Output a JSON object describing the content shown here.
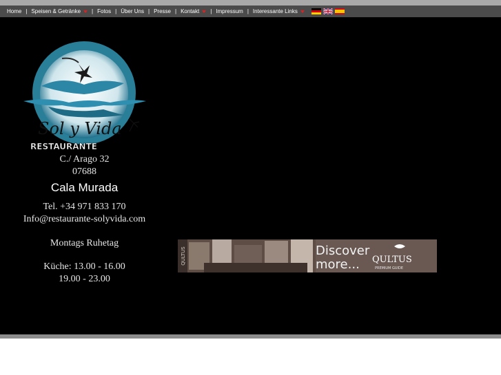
{
  "nav": {
    "items": [
      {
        "label": "Home",
        "dropdown": false
      },
      {
        "label": "Speisen & Getränke",
        "dropdown": true
      },
      {
        "label": "Fotos",
        "dropdown": false
      },
      {
        "label": "Über Uns",
        "dropdown": false
      },
      {
        "label": "Presse",
        "dropdown": false
      },
      {
        "label": "Kontakt",
        "dropdown": true
      },
      {
        "label": "Impressum",
        "dropdown": false
      },
      {
        "label": "Interessante Links",
        "dropdown": true
      }
    ],
    "separator": "|",
    "flags": [
      "flag-de-icon",
      "flag-uk-icon",
      "flag-es-icon"
    ],
    "dropdown_color": "#e02020"
  },
  "logo": {
    "name": "Sol y Vida",
    "subtitle": "RESTAURANTE"
  },
  "contact": {
    "street": "C./ Arago 32",
    "zip": "07688",
    "city": "Cala Murada",
    "phone": "Tel. +34 971 833 170",
    "email": "Info@restaurante-solyvida.com",
    "closed": "Montags Ruhetag",
    "kitchen_1": "Küche: 13.00 - 16.00",
    "kitchen_2": "19.00 - 23.00"
  },
  "banner": {
    "side": "QULTUS",
    "headline_1": "Discover",
    "headline_2": "more...",
    "brand": "QULTUS",
    "brand_sub": "PREMIUM GUIDE"
  },
  "colors": {
    "nav_bg": "#4b4b4b",
    "page_bg": "#000000",
    "top_strip": "#a9a9a9",
    "bottom_strip": "#8c8c8c"
  }
}
